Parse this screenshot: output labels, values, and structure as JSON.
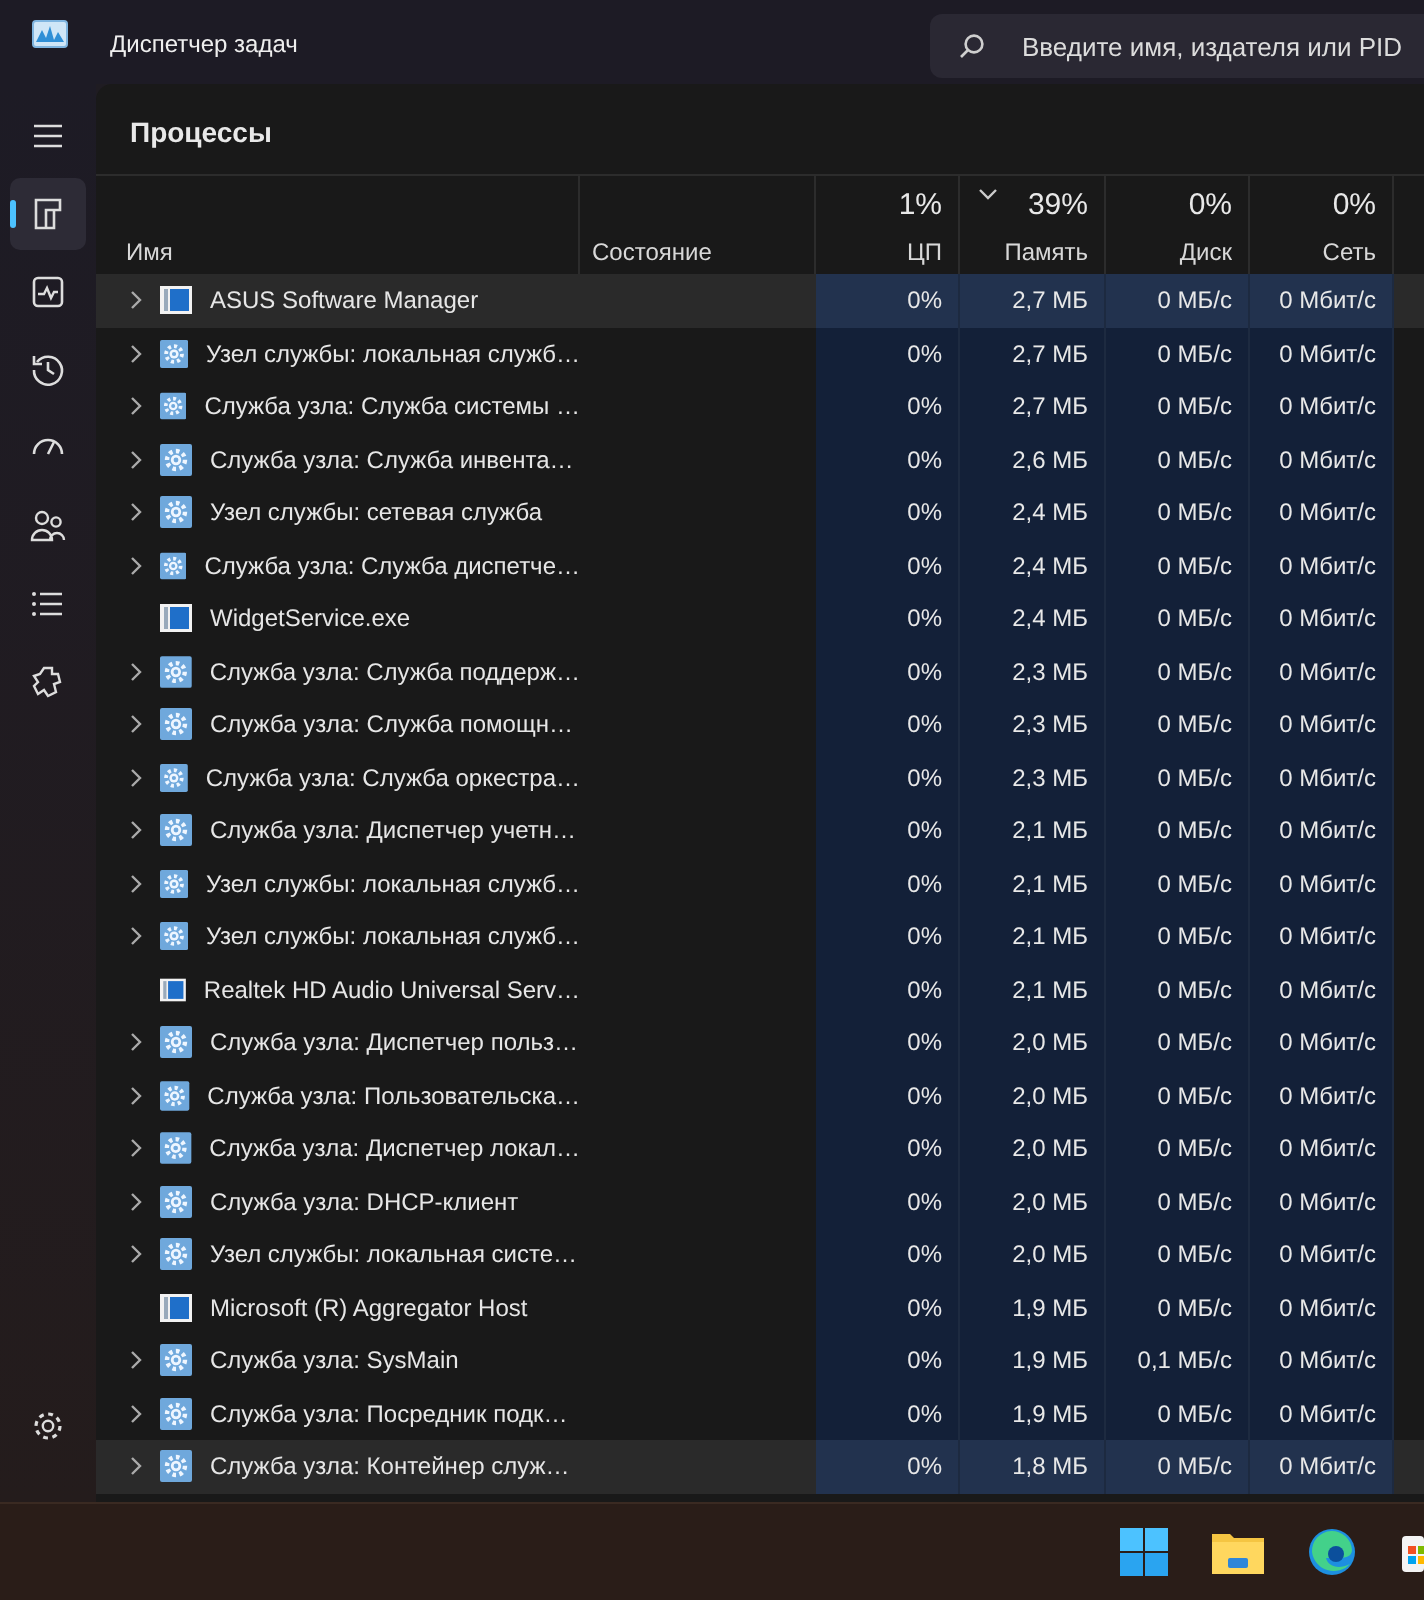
{
  "window": {
    "title": "Диспетчер задач"
  },
  "search": {
    "placeholder": "Введите имя, издателя или PID"
  },
  "nav": {
    "items": [
      {
        "kind": "processes",
        "selected": true
      },
      {
        "kind": "performance",
        "selected": false
      },
      {
        "kind": "history",
        "selected": false
      },
      {
        "kind": "startup",
        "selected": false
      },
      {
        "kind": "users",
        "selected": false
      },
      {
        "kind": "details",
        "selected": false
      },
      {
        "kind": "services",
        "selected": false
      }
    ]
  },
  "page_title": "Процессы",
  "table": {
    "columns": [
      {
        "label": "Имя",
        "sorted": false
      },
      {
        "label": "Состояние",
        "sorted": false
      },
      {
        "label": "ЦП",
        "percent": "1%",
        "sorted": false
      },
      {
        "label": "Память",
        "percent": "39%",
        "sorted": true
      },
      {
        "label": "Диск",
        "percent": "0%",
        "sorted": false
      },
      {
        "label": "Сеть",
        "percent": "0%",
        "sorted": false
      }
    ],
    "rows": [
      {
        "name": "ASUS Software Manager",
        "kind": "app",
        "expandable": true,
        "highlighted": true,
        "cpu": "0%",
        "memory": "2,7 МБ",
        "disk": "0 МБ/с",
        "network": "0 Мбит/с"
      },
      {
        "name": "Узел службы: локальная служб…",
        "kind": "service",
        "expandable": true,
        "highlighted": false,
        "cpu": "0%",
        "memory": "2,7 МБ",
        "disk": "0 МБ/с",
        "network": "0 Мбит/с"
      },
      {
        "name": "Служба узла: Служба системы …",
        "kind": "service",
        "expandable": true,
        "highlighted": false,
        "cpu": "0%",
        "memory": "2,7 МБ",
        "disk": "0 МБ/с",
        "network": "0 Мбит/с"
      },
      {
        "name": "Служба узла: Служба инвента…",
        "kind": "service",
        "expandable": true,
        "highlighted": false,
        "cpu": "0%",
        "memory": "2,6 МБ",
        "disk": "0 МБ/с",
        "network": "0 Мбит/с"
      },
      {
        "name": "Узел службы: сетевая служба",
        "kind": "service",
        "expandable": true,
        "highlighted": false,
        "cpu": "0%",
        "memory": "2,4 МБ",
        "disk": "0 МБ/с",
        "network": "0 Мбит/с"
      },
      {
        "name": "Служба узла: Служба диспетче…",
        "kind": "service",
        "expandable": true,
        "highlighted": false,
        "cpu": "0%",
        "memory": "2,4 МБ",
        "disk": "0 МБ/с",
        "network": "0 Мбит/с"
      },
      {
        "name": "WidgetService.exe",
        "kind": "app",
        "expandable": false,
        "highlighted": false,
        "cpu": "0%",
        "memory": "2,4 МБ",
        "disk": "0 МБ/с",
        "network": "0 Мбит/с"
      },
      {
        "name": "Служба узла: Служба поддерж…",
        "kind": "service",
        "expandable": true,
        "highlighted": false,
        "cpu": "0%",
        "memory": "2,3 МБ",
        "disk": "0 МБ/с",
        "network": "0 Мбит/с"
      },
      {
        "name": "Служба узла: Служба помощн…",
        "kind": "service",
        "expandable": true,
        "highlighted": false,
        "cpu": "0%",
        "memory": "2,3 МБ",
        "disk": "0 МБ/с",
        "network": "0 Мбит/с"
      },
      {
        "name": "Служба узла: Служба оркестра…",
        "kind": "service",
        "expandable": true,
        "highlighted": false,
        "cpu": "0%",
        "memory": "2,3 МБ",
        "disk": "0 МБ/с",
        "network": "0 Мбит/с"
      },
      {
        "name": "Служба узла: Диспетчер учетн…",
        "kind": "service",
        "expandable": true,
        "highlighted": false,
        "cpu": "0%",
        "memory": "2,1 МБ",
        "disk": "0 МБ/с",
        "network": "0 Мбит/с"
      },
      {
        "name": "Узел службы: локальная служб…",
        "kind": "service",
        "expandable": true,
        "highlighted": false,
        "cpu": "0%",
        "memory": "2,1 МБ",
        "disk": "0 МБ/с",
        "network": "0 Мбит/с"
      },
      {
        "name": "Узел службы: локальная служб…",
        "kind": "service",
        "expandable": true,
        "highlighted": false,
        "cpu": "0%",
        "memory": "2,1 МБ",
        "disk": "0 МБ/с",
        "network": "0 Мбит/с"
      },
      {
        "name": "Realtek HD Audio Universal Serv…",
        "kind": "app",
        "expandable": false,
        "highlighted": false,
        "cpu": "0%",
        "memory": "2,1 МБ",
        "disk": "0 МБ/с",
        "network": "0 Мбит/с"
      },
      {
        "name": "Служба узла: Диспетчер польз…",
        "kind": "service",
        "expandable": true,
        "highlighted": false,
        "cpu": "0%",
        "memory": "2,0 МБ",
        "disk": "0 МБ/с",
        "network": "0 Мбит/с"
      },
      {
        "name": "Служба узла: Пользовательска…",
        "kind": "service",
        "expandable": true,
        "highlighted": false,
        "cpu": "0%",
        "memory": "2,0 МБ",
        "disk": "0 МБ/с",
        "network": "0 Мбит/с"
      },
      {
        "name": "Служба узла: Диспетчер локал…",
        "kind": "service",
        "expandable": true,
        "highlighted": false,
        "cpu": "0%",
        "memory": "2,0 МБ",
        "disk": "0 МБ/с",
        "network": "0 Мбит/с"
      },
      {
        "name": "Служба узла: DHCP-клиент",
        "kind": "service",
        "expandable": true,
        "highlighted": false,
        "cpu": "0%",
        "memory": "2,0 МБ",
        "disk": "0 МБ/с",
        "network": "0 Мбит/с"
      },
      {
        "name": "Узел службы: локальная систе…",
        "kind": "service",
        "expandable": true,
        "highlighted": false,
        "cpu": "0%",
        "memory": "2,0 МБ",
        "disk": "0 МБ/с",
        "network": "0 Мбит/с"
      },
      {
        "name": "Microsoft (R) Aggregator Host",
        "kind": "app",
        "expandable": false,
        "highlighted": false,
        "cpu": "0%",
        "memory": "1,9 МБ",
        "disk": "0 МБ/с",
        "network": "0 Мбит/с"
      },
      {
        "name": "Служба узла: SysMain",
        "kind": "service",
        "expandable": true,
        "highlighted": false,
        "cpu": "0%",
        "memory": "1,9 МБ",
        "disk": "0,1 МБ/с",
        "network": "0 Мбит/с"
      },
      {
        "name": "Служба узла: Посредник подк…",
        "kind": "service",
        "expandable": true,
        "highlighted": false,
        "cpu": "0%",
        "memory": "1,9 МБ",
        "disk": "0 МБ/с",
        "network": "0 Мбит/с"
      },
      {
        "name": "Служба узла: Контейнер служ…",
        "kind": "service",
        "expandable": true,
        "highlighted": true,
        "cpu": "0%",
        "memory": "1,8 МБ",
        "disk": "0 МБ/с",
        "network": "0 Мбит/с"
      }
    ]
  },
  "taskbar": {
    "items": [
      {
        "kind": "start"
      },
      {
        "kind": "explorer"
      },
      {
        "kind": "browser"
      },
      {
        "kind": "store"
      }
    ]
  }
}
